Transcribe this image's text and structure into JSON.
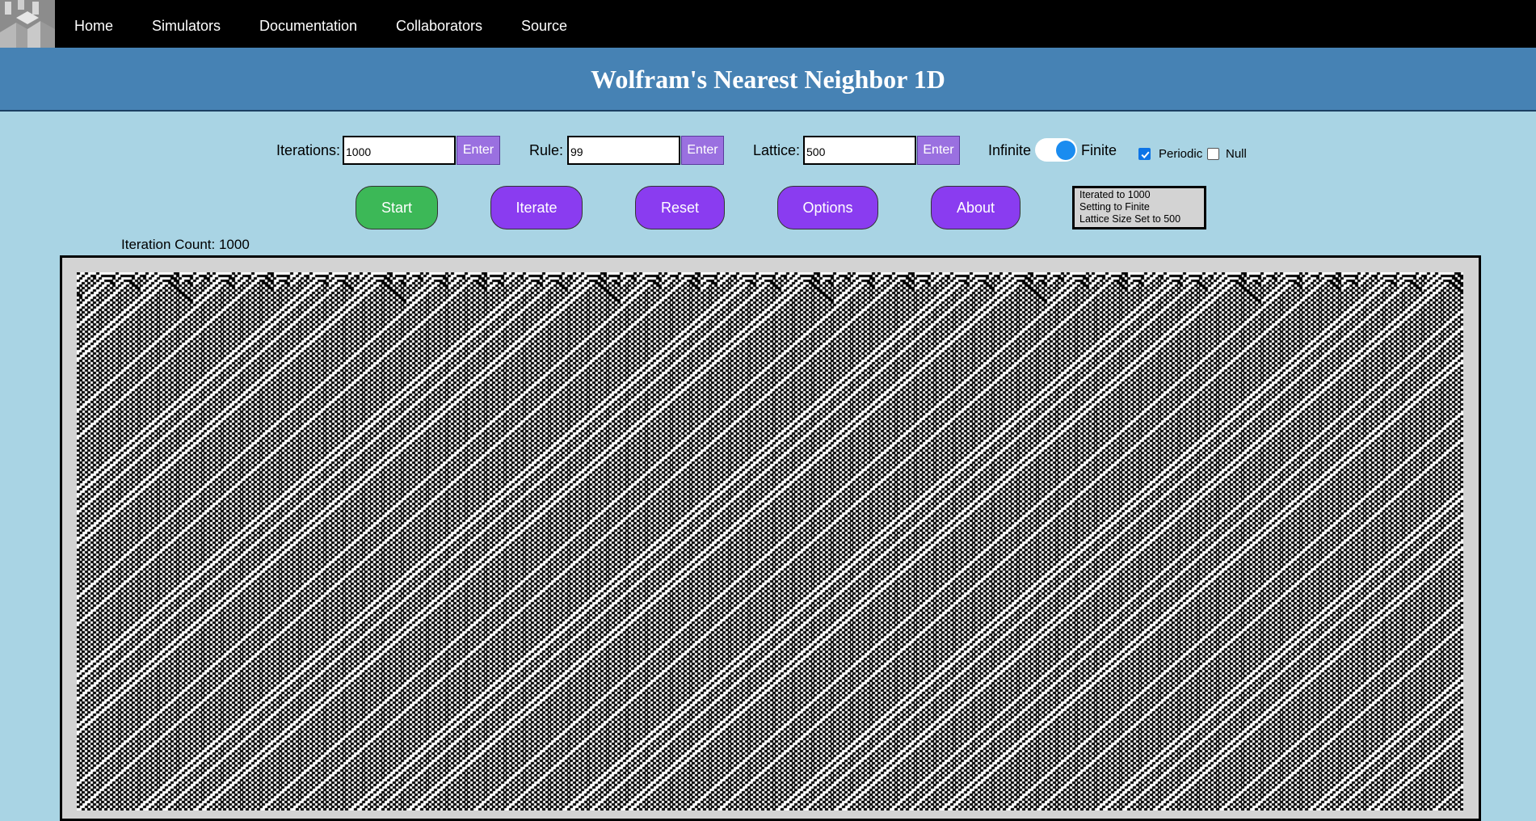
{
  "nav": {
    "logo": "castle-logo",
    "items": [
      "Home",
      "Simulators",
      "Documentation",
      "Collaborators",
      "Source"
    ]
  },
  "header": {
    "title": "Wolfram's Nearest Neighbor 1D"
  },
  "controls": {
    "iterations": {
      "label": "Iterations:",
      "value": "1000",
      "button": "Enter"
    },
    "rule": {
      "label": "Rule:",
      "value": "99",
      "button": "Enter"
    },
    "lattice": {
      "label": "Lattice:",
      "value": "500",
      "button": "Enter"
    },
    "boundary": {
      "left_label": "Infinite",
      "right_label": "Finite",
      "selected": "Finite"
    },
    "periodic": {
      "label": "Periodic",
      "checked": true
    },
    "null": {
      "label": "Null",
      "checked": false
    }
  },
  "buttons": {
    "start": "Start",
    "iterate": "Iterate",
    "reset": "Reset",
    "options": "Options",
    "about": "About"
  },
  "status_log": [
    "Iterated to 1000",
    "Setting to Finite",
    "Lattice Size Set to 500"
  ],
  "iteration_count": "Iteration Count: 1000",
  "simulation": {
    "rule": 99,
    "lattice_size": 500,
    "boundary": "periodic"
  },
  "colors": {
    "nav_bg": "#000000",
    "banner_bg": "#4682b4",
    "page_bg": "#a9d4e4",
    "button_purple": "#8a3cf0",
    "button_green": "#3cb857",
    "enter_button": "#9a70e0"
  }
}
